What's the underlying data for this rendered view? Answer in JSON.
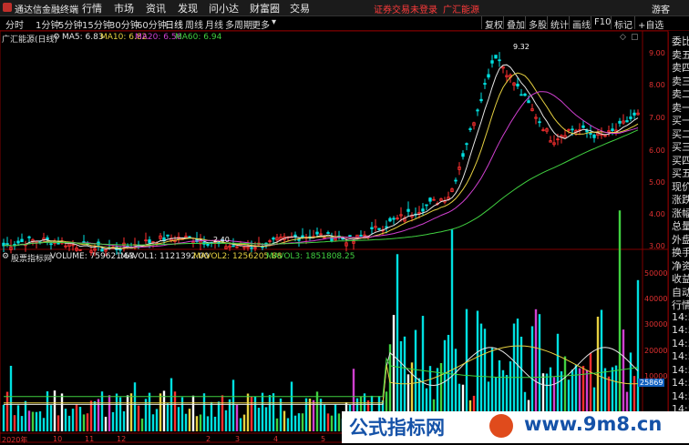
{
  "window": {
    "app_title": "通达信金融终端",
    "menus": [
      "行情",
      "市场",
      "资讯",
      "发现",
      "问小达",
      "财富圈",
      "交易"
    ],
    "login_warning": "证券交易未登录",
    "broker_link": "广汇能源",
    "guest_label": "游客"
  },
  "periods": [
    "分时",
    "1分钟",
    "5分钟",
    "15分钟",
    "30分钟",
    "60分钟",
    "日线",
    "周线",
    "月线",
    "多周期",
    "更多"
  ],
  "active_period": "日线",
  "toolbar_buttons": [
    "复权",
    "叠加",
    "多股",
    "统计",
    "画线",
    "F10",
    "标记",
    "+自选"
  ],
  "main_chart": {
    "stock_label": "广汇能源(日线)",
    "ma_labels": [
      {
        "text": "MA5: 6.83",
        "color": "#e6e6e6"
      },
      {
        "text": "MA10: 6.82",
        "color": "#e6d040"
      },
      {
        "text": "MA20: 6.56",
        "color": "#d040d0"
      },
      {
        "text": "MA60: 6.94",
        "color": "#40d040"
      }
    ],
    "price_axis": [
      "9.00",
      "8.00",
      "7.00",
      "6.00",
      "5.00",
      "4.00",
      "3.00"
    ],
    "high_label": "9.32",
    "low_label": "2.40"
  },
  "volume_chart": {
    "indicator_label": "股票指标网",
    "volume_labels": [
      {
        "text": "VOLUME: 759621.63",
        "color": "#e6e6e6"
      },
      {
        "text": "MAVOL1: 1121392.00",
        "color": "#e6e6e6"
      },
      {
        "text": "MAVOL2: 1256205.88",
        "color": "#e6d040"
      },
      {
        "text": "MAVOL3: 1851808.25",
        "color": "#40d040"
      }
    ],
    "volume_axis": [
      "50000",
      "40000",
      "30000",
      "20000",
      "10000"
    ],
    "current_volume": "25869"
  },
  "date_axis": [
    "2020年",
    "10",
    "11",
    "12",
    "2",
    "3",
    "4",
    "5"
  ],
  "right_panel": [
    "委比",
    "卖五",
    "卖四",
    "卖三",
    "卖二",
    "卖一",
    "买一",
    "买二",
    "买三",
    "买四",
    "买五",
    "现价",
    "涨跌",
    "涨幅",
    "总量",
    "外盘",
    "换手",
    "净资",
    "收益",
    "自动",
    "行情",
    "14:5",
    "14:5",
    "14:5",
    "14:5",
    "14:5",
    "14:5",
    "14:5",
    "14:5",
    "14:5",
    "14:5"
  ],
  "watermark": {
    "left_text": "公式指标网",
    "right_text": "www.9m8.cn"
  },
  "colors": {
    "up": "#ff3030",
    "down": "#00e0e0",
    "border": "#800000",
    "accent_red": "#e03030"
  }
}
